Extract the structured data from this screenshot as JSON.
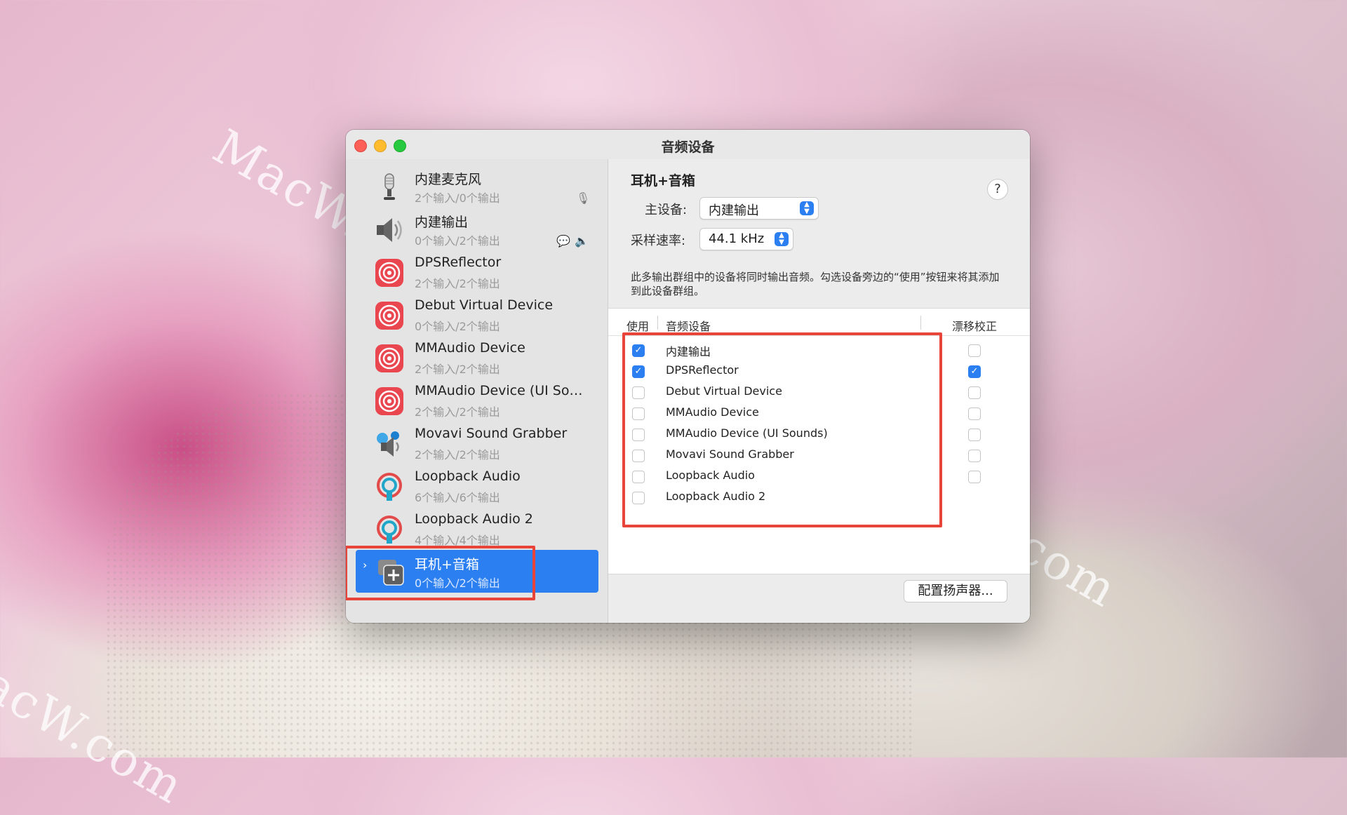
{
  "window": {
    "title": "音频设备"
  },
  "watermark": "MacW.com",
  "sidebar": {
    "devices": [
      {
        "name": "内建麦克风",
        "sub": "2个输入/0个输出",
        "icon": "microphone-icon"
      },
      {
        "name": "内建输出",
        "sub": "0个输入/2个输出",
        "icon": "speaker-icon"
      },
      {
        "name": "DPSReflector",
        "sub": "2个输入/2个输出",
        "icon": "target-red-icon"
      },
      {
        "name": "Debut Virtual Device",
        "sub": "0个输入/2个输出",
        "icon": "target-red-icon"
      },
      {
        "name": "MMAudio Device",
        "sub": "2个输入/2个输出",
        "icon": "target-red-icon"
      },
      {
        "name": "MMAudio Device (UI Sou...",
        "sub": "2个输入/2个输出",
        "icon": "target-red-icon"
      },
      {
        "name": "Movavi Sound Grabber",
        "sub": "2个输入/2个输出",
        "icon": "movavi-speaker-icon"
      },
      {
        "name": "Loopback Audio",
        "sub": "6个输入/6个输出",
        "icon": "loopback-icon"
      },
      {
        "name": "Loopback Audio 2",
        "sub": "4个输入/4个输出",
        "icon": "loopback-icon"
      },
      {
        "name": "耳机+音箱",
        "sub": "0个输入/2个输出",
        "icon": "multi-output-icon",
        "selected": true
      }
    ],
    "bottom": {
      "add": "+",
      "remove": "−",
      "gear": "⚙",
      "menu": "⌄"
    }
  },
  "panel": {
    "heading": "耳机+音箱",
    "help": "?",
    "master_label": "主设备:",
    "master_value": "内建输出",
    "rate_label": "采样速率:",
    "rate_value": "44.1 kHz",
    "description": "此多输出群组中的设备将同时输出音频。勾选设备旁边的“使用”按钮来将其添加到此设备群组。",
    "columns": {
      "use": "使用",
      "device": "音频设备",
      "drift": "漂移校正"
    },
    "rows": [
      {
        "name": "内建输出",
        "use": true,
        "drift": false
      },
      {
        "name": "DPSReflector",
        "use": true,
        "drift": true
      },
      {
        "name": "Debut Virtual Device",
        "use": false,
        "drift": false
      },
      {
        "name": "MMAudio Device",
        "use": false,
        "drift": false
      },
      {
        "name": "MMAudio Device (UI Sounds)",
        "use": false,
        "drift": false
      },
      {
        "name": "Movavi Sound Grabber",
        "use": false,
        "drift": false
      },
      {
        "name": "Loopback Audio",
        "use": false,
        "drift": false
      },
      {
        "name": "Loopback Audio 2",
        "use": false,
        "drift": false
      }
    ],
    "config_button": "配置扬声器..."
  }
}
